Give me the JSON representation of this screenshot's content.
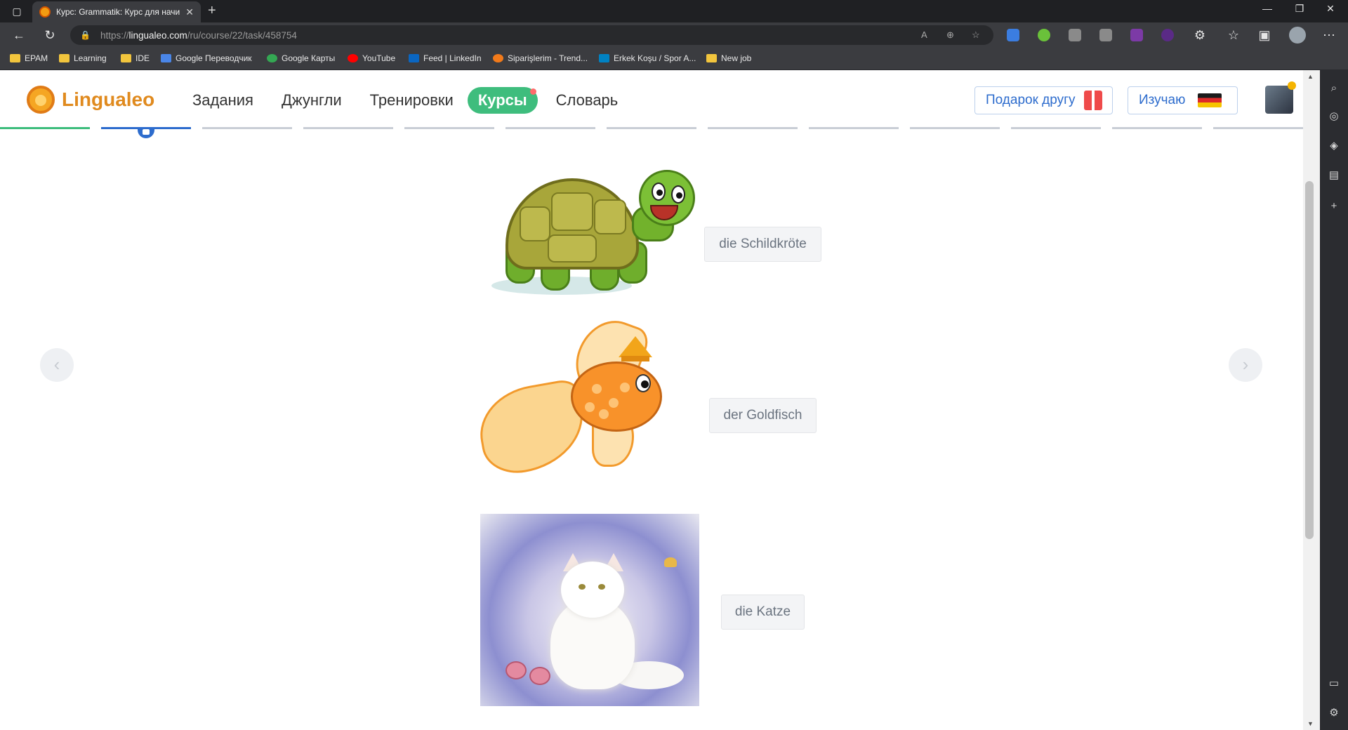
{
  "browser": {
    "tab_title": "Курс: Grammatik: Курс для начи",
    "url_prefix": "https://",
    "url_host": "lingualeo.com",
    "url_path": "/ru/course/22/task/458754",
    "bookmarks": [
      {
        "label": "EPAM",
        "icon": "folder-icon"
      },
      {
        "label": "Learning",
        "icon": "folder-icon"
      },
      {
        "label": "IDE",
        "icon": "folder-icon"
      },
      {
        "label": "Google Переводчик",
        "icon": "google-translate-icon"
      },
      {
        "label": "Google Карты",
        "icon": "google-maps-icon"
      },
      {
        "label": "YouTube",
        "icon": "youtube-icon"
      },
      {
        "label": "Feed | LinkedIn",
        "icon": "linkedin-icon"
      },
      {
        "label": "Siparişlerim - Trend...",
        "icon": "trendyol-icon"
      },
      {
        "label": "Erkek Koşu / Spor A...",
        "icon": "decathlon-icon"
      },
      {
        "label": "New job",
        "icon": "folder-icon"
      }
    ]
  },
  "header": {
    "logo_text": "Lingualeo",
    "nav": [
      "Задания",
      "Джунгли",
      "Тренировки",
      "Курсы",
      "Словарь"
    ],
    "active_nav": "Курсы",
    "gift_label": "Подарок другу",
    "learning_label": "Изучаю",
    "learning_language_flag": "german-flag-icon"
  },
  "progress": {
    "segments_total": 13,
    "segments_done": 1,
    "current_segment": 2
  },
  "cards": [
    {
      "word": "die Schildkröte",
      "image": "turtle-illustration"
    },
    {
      "word": "der Goldfisch",
      "image": "goldfish-illustration"
    },
    {
      "word": "die Katze",
      "image": "cat-painting"
    }
  ],
  "colors": {
    "brand_orange": "#e08a1e",
    "active_green": "#3ebd7d",
    "link_blue": "#2d6ccd"
  }
}
